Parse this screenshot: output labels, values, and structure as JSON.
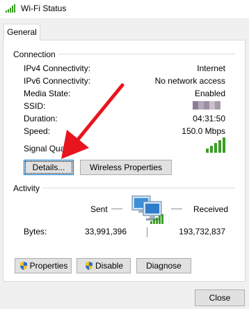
{
  "window": {
    "title": "Wi-Fi Status"
  },
  "tabs": [
    {
      "label": "General"
    }
  ],
  "connection": {
    "heading": "Connection",
    "rows": [
      {
        "label": "IPv4 Connectivity:",
        "value": "Internet"
      },
      {
        "label": "IPv6 Connectivity:",
        "value": "No network access"
      },
      {
        "label": "Media State:",
        "value": "Enabled"
      },
      {
        "label": "SSID:",
        "value": ""
      },
      {
        "label": "Duration:",
        "value": "04:31:50"
      },
      {
        "label": "Speed:",
        "value": "150.0 Mbps"
      }
    ],
    "signal_label": "Signal Quality",
    "signal_bars_lit": 5,
    "signal_bars_total": 5,
    "details_button": "Details...",
    "wireless_properties_button": "Wireless Properties"
  },
  "activity": {
    "heading": "Activity",
    "sent_label": "Sent",
    "received_label": "Received",
    "bytes_label": "Bytes:",
    "bytes_sent": "33,991,396",
    "bytes_received": "193,732,837"
  },
  "buttons": {
    "properties": "Properties",
    "disable": "Disable",
    "diagnose": "Diagnose",
    "close": "Close"
  },
  "icons": {
    "title": "wifi-signal-icon",
    "network": "network-computers-icon",
    "shield": "uac-shield-icon",
    "annotation": "red-arrow"
  },
  "colors": {
    "signal_green": "#3c9c28",
    "focus_blue": "#0078d7",
    "arrow_red": "#e8141e"
  }
}
